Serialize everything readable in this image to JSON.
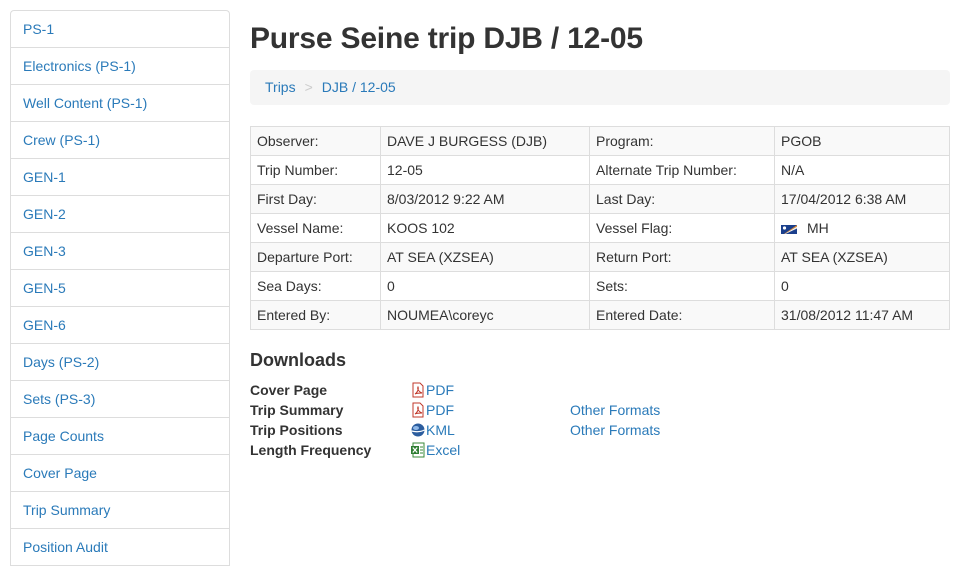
{
  "sidebar": {
    "items": [
      {
        "label": "PS-1"
      },
      {
        "label": "Electronics (PS-1)"
      },
      {
        "label": "Well Content (PS-1)"
      },
      {
        "label": "Crew (PS-1)"
      },
      {
        "label": "GEN-1"
      },
      {
        "label": "GEN-2"
      },
      {
        "label": "GEN-3"
      },
      {
        "label": "GEN-5"
      },
      {
        "label": "GEN-6"
      },
      {
        "label": "Days (PS-2)"
      },
      {
        "label": "Sets (PS-3)"
      },
      {
        "label": "Page Counts"
      },
      {
        "label": "Cover Page"
      },
      {
        "label": "Trip Summary"
      },
      {
        "label": "Position Audit"
      }
    ]
  },
  "page": {
    "title": "Purse Seine trip DJB / 12-05"
  },
  "breadcrumb": {
    "items": [
      "Trips",
      "DJB / 12-05"
    ],
    "separator": ">"
  },
  "info": {
    "rows": [
      {
        "l1": "Observer:",
        "v1": "DAVE J BURGESS (DJB)",
        "l2": "Program:",
        "v2": "PGOB"
      },
      {
        "l1": "Trip Number:",
        "v1": "12-05",
        "l2": "Alternate Trip Number:",
        "v2": "N/A"
      },
      {
        "l1": "First Day:",
        "v1": "8/03/2012 9:22 AM",
        "l2": "Last Day:",
        "v2": "17/04/2012 6:38 AM"
      },
      {
        "l1": "Vessel Name:",
        "v1": "KOOS 102",
        "l2": "Vessel Flag:",
        "v2": "MH"
      },
      {
        "l1": "Departure Port:",
        "v1": "AT SEA (XZSEA)",
        "l2": "Return Port:",
        "v2": "AT SEA (XZSEA)"
      },
      {
        "l1": "Sea Days:",
        "v1": "0",
        "l2": "Sets:",
        "v2": "0"
      },
      {
        "l1": "Entered By:",
        "v1": "NOUMEA\\coreyc",
        "l2": "Entered Date:",
        "v2": "31/08/2012 11:47 AM"
      }
    ]
  },
  "downloads": {
    "title": "Downloads",
    "rows": [
      {
        "label": "Cover Page",
        "file": "PDF",
        "icon": "pdf-icon",
        "other": ""
      },
      {
        "label": "Trip Summary",
        "file": "PDF",
        "icon": "pdf-icon",
        "other": "Other Formats"
      },
      {
        "label": "Trip Positions",
        "file": "KML",
        "icon": "globe-icon",
        "other": "Other Formats"
      },
      {
        "label": "Length Frequency",
        "file": "Excel",
        "icon": "excel-icon",
        "other": ""
      }
    ]
  },
  "colors": {
    "link": "#2a7ab9",
    "border": "#dddddd",
    "stripe": "#f9f9f9",
    "breadcrumb_bg": "#f5f5f5"
  }
}
